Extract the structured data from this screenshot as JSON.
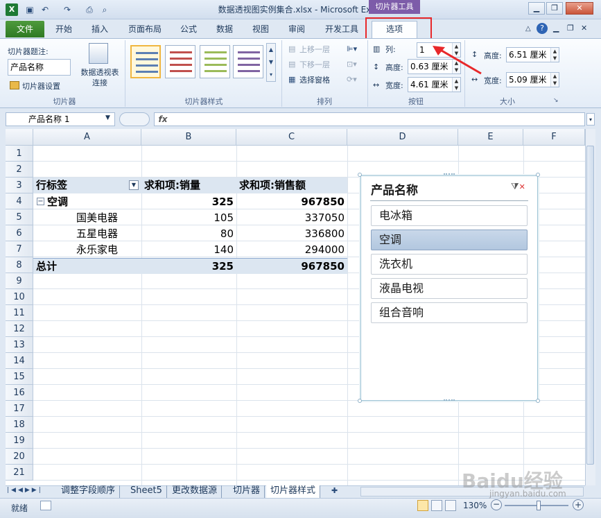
{
  "window": {
    "title": "数据透视图实例集合.xlsx - Microsoft Excel",
    "contextual_tab_group": "切片器工具"
  },
  "ribbon_tabs": [
    "文件",
    "开始",
    "插入",
    "页面布局",
    "公式",
    "数据",
    "视图",
    "审阅",
    "开发工具",
    "选项"
  ],
  "ribbon": {
    "slicer_group": {
      "caption_label": "切片器题注:",
      "caption_value": "产品名称",
      "settings_label": "切片器设置",
      "pivot_connections_label": "数据透视表连接",
      "group_label": "切片器"
    },
    "styles_group": {
      "group_label": "切片器样式"
    },
    "arrange_group": {
      "bring_forward": "上移一层",
      "send_backward": "下移一层",
      "selection_pane": "选择窗格",
      "group_label": "排列"
    },
    "buttons_group": {
      "columns_label": "列:",
      "columns_value": "1",
      "height_label": "高度:",
      "height_value": "0.63 厘米",
      "width_label": "宽度:",
      "width_value": "4.61 厘米",
      "group_label": "按钮"
    },
    "size_group": {
      "height_label": "高度:",
      "height_value": "6.51 厘米",
      "width_label": "宽度:",
      "width_value": "5.09 厘米",
      "group_label": "大小"
    }
  },
  "formula_bar": {
    "name_box": "产品名称 1",
    "fx": "fx",
    "value": ""
  },
  "columns": [
    "A",
    "B",
    "C",
    "D",
    "E",
    "F"
  ],
  "rows": [
    "1",
    "2",
    "3",
    "4",
    "5",
    "6",
    "7",
    "8",
    "9",
    "10",
    "11",
    "12",
    "13",
    "14",
    "15",
    "16",
    "17",
    "18",
    "19",
    "20",
    "21"
  ],
  "pivot": {
    "headers": [
      "行标签",
      "求和项:销量",
      "求和项:销售额"
    ],
    "group_row": {
      "label": "空调",
      "qty": "325",
      "sales": "967850"
    },
    "detail_rows": [
      {
        "label": "国美电器",
        "qty": "105",
        "sales": "337050"
      },
      {
        "label": "五星电器",
        "qty": "80",
        "sales": "336800"
      },
      {
        "label": "永乐家电",
        "qty": "140",
        "sales": "294000"
      }
    ],
    "total_row": {
      "label": "总计",
      "qty": "325",
      "sales": "967850"
    }
  },
  "slicer": {
    "title": "产品名称",
    "items": [
      "电冰箱",
      "空调",
      "洗衣机",
      "液晶电视",
      "组合音响"
    ],
    "selected": "空调"
  },
  "sheet_tabs": [
    "调整字段顺序",
    "Sheet5",
    "更改数据源",
    "切片器",
    "切片器样式"
  ],
  "active_sheet": "切片器样式",
  "status": {
    "ready": "就绪",
    "zoom": "130%"
  },
  "watermark": {
    "brand": "Baidu经验",
    "url": "jingyan.baidu.com"
  },
  "colors": {
    "accent_red": "#e8282a",
    "file_tab": "#2f7a23",
    "context_purple": "#7d5ca9",
    "pivot_band": "#dce6f1",
    "slicer_selected": "#b2c7df"
  }
}
